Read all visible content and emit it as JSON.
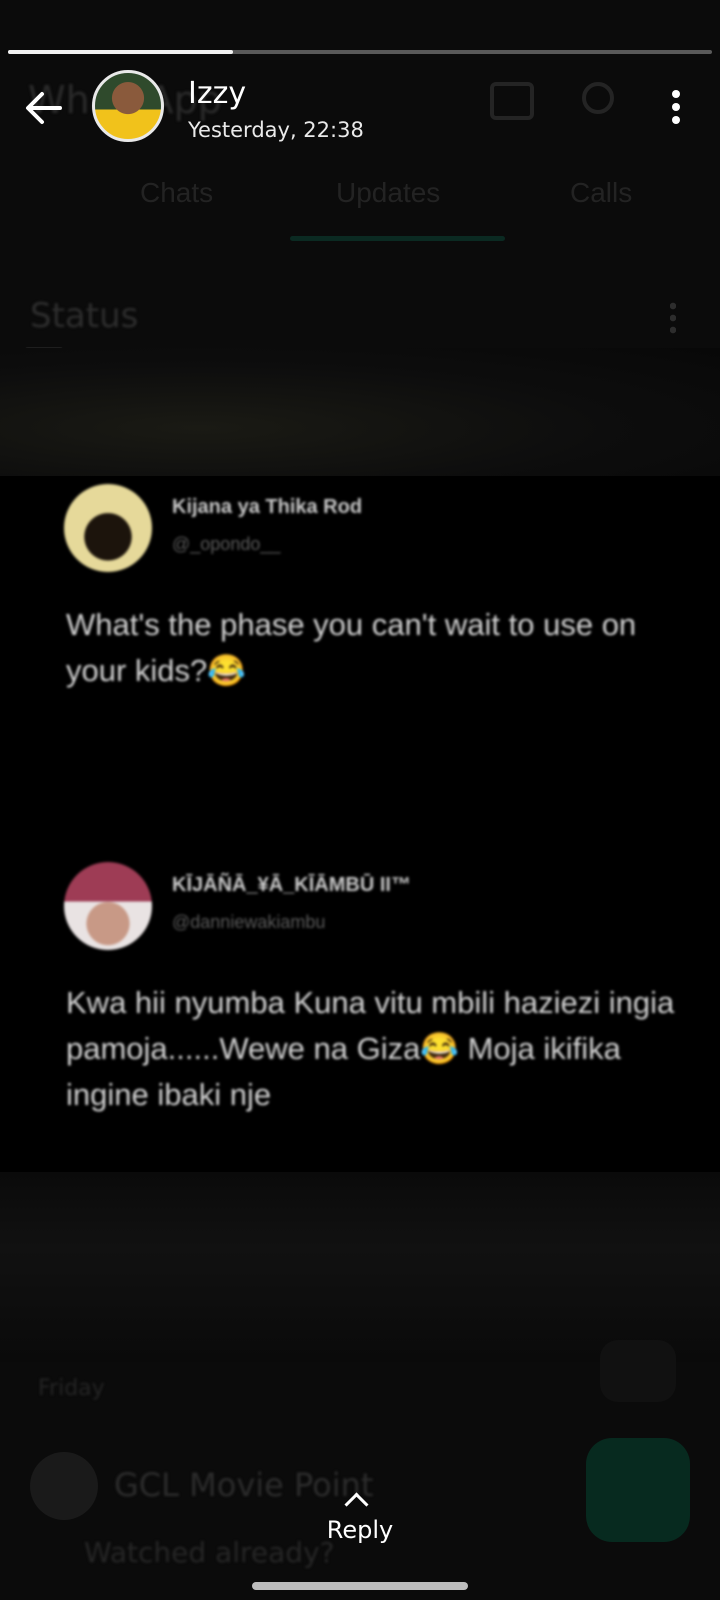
{
  "background": {
    "app_title": "WhatsApp",
    "tabs": [
      "Chats",
      "Updates",
      "Calls"
    ],
    "status_label": "Status",
    "friday_label": "Friday",
    "recent_contact": "GCL Movie Point",
    "recent_caption": "Watched already?"
  },
  "progress": {
    "segments": 3,
    "current": 1,
    "fill_fraction": 0.32
  },
  "header": {
    "name": "Izzy",
    "time": "Yesterday, 22:38",
    "icons": [
      "back-arrow-icon",
      "camera-icon",
      "search-icon",
      "more-vert-icon"
    ]
  },
  "tweets": [
    {
      "display_name": "Kijana ya Thika Rod",
      "handle": "@_opondo__",
      "text": "What's the phase you can't wait to use on your kids?😂"
    },
    {
      "display_name": "KĪJĀÑĀ_¥Ā_KĪĀMBŪ II™",
      "handle": "@danniewakiambu",
      "text": "Kwa hii nyumba Kuna vitu mbili haziezi ingia pamoja......Wewe na Giza😂 Moja ikifika ingine ibaki nje"
    }
  ],
  "reply": {
    "label": "Reply"
  },
  "colors": {
    "accent_dark": "#072a1f",
    "text": "#ffffff"
  }
}
